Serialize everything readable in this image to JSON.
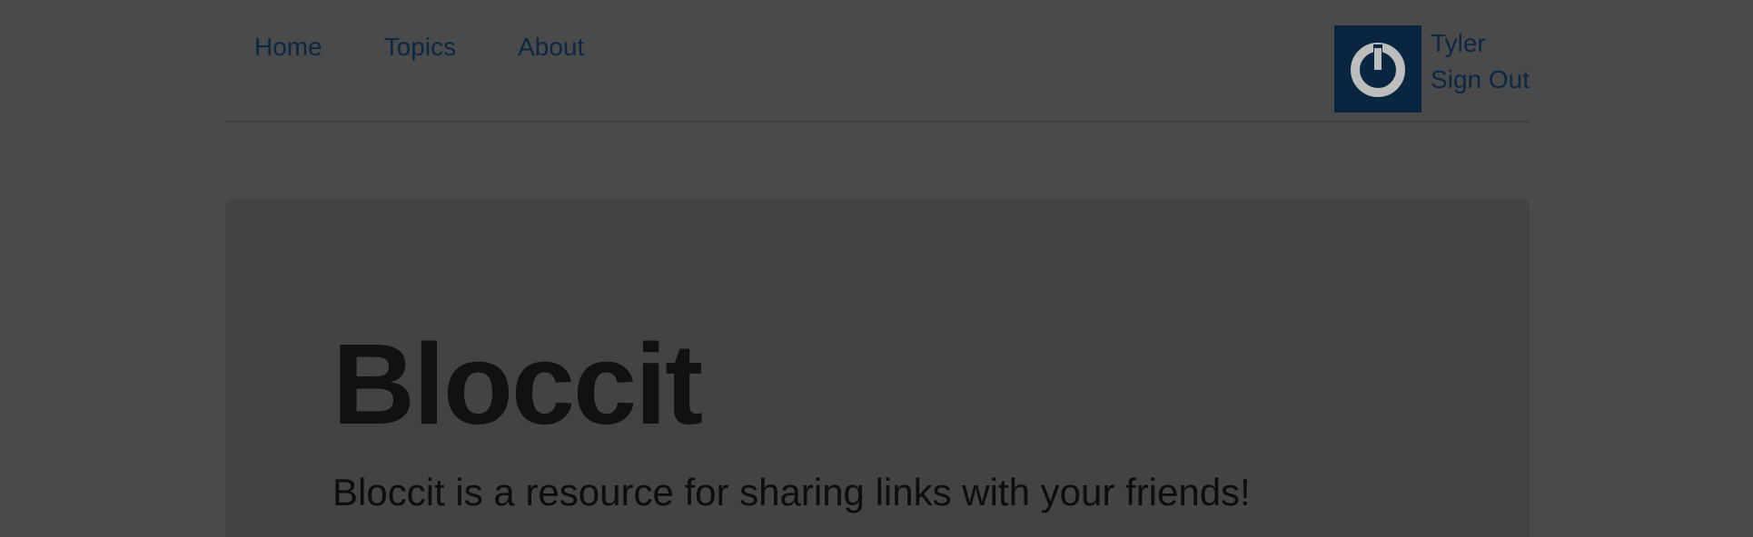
{
  "nav": {
    "links": [
      {
        "label": "Home"
      },
      {
        "label": "Topics"
      },
      {
        "label": "About"
      }
    ]
  },
  "user": {
    "name": "Tyler",
    "sign_out_label": "Sign Out",
    "avatar_icon": "power-icon",
    "avatar_bg": "#0a2540"
  },
  "jumbotron": {
    "title": "Bloccit",
    "lead": "Bloccit is a resource for sharing links with your friends!"
  },
  "colors": {
    "link": "#0b2744",
    "page_bg": "#4a4a4a",
    "jumbotron_bg": "#434343"
  }
}
